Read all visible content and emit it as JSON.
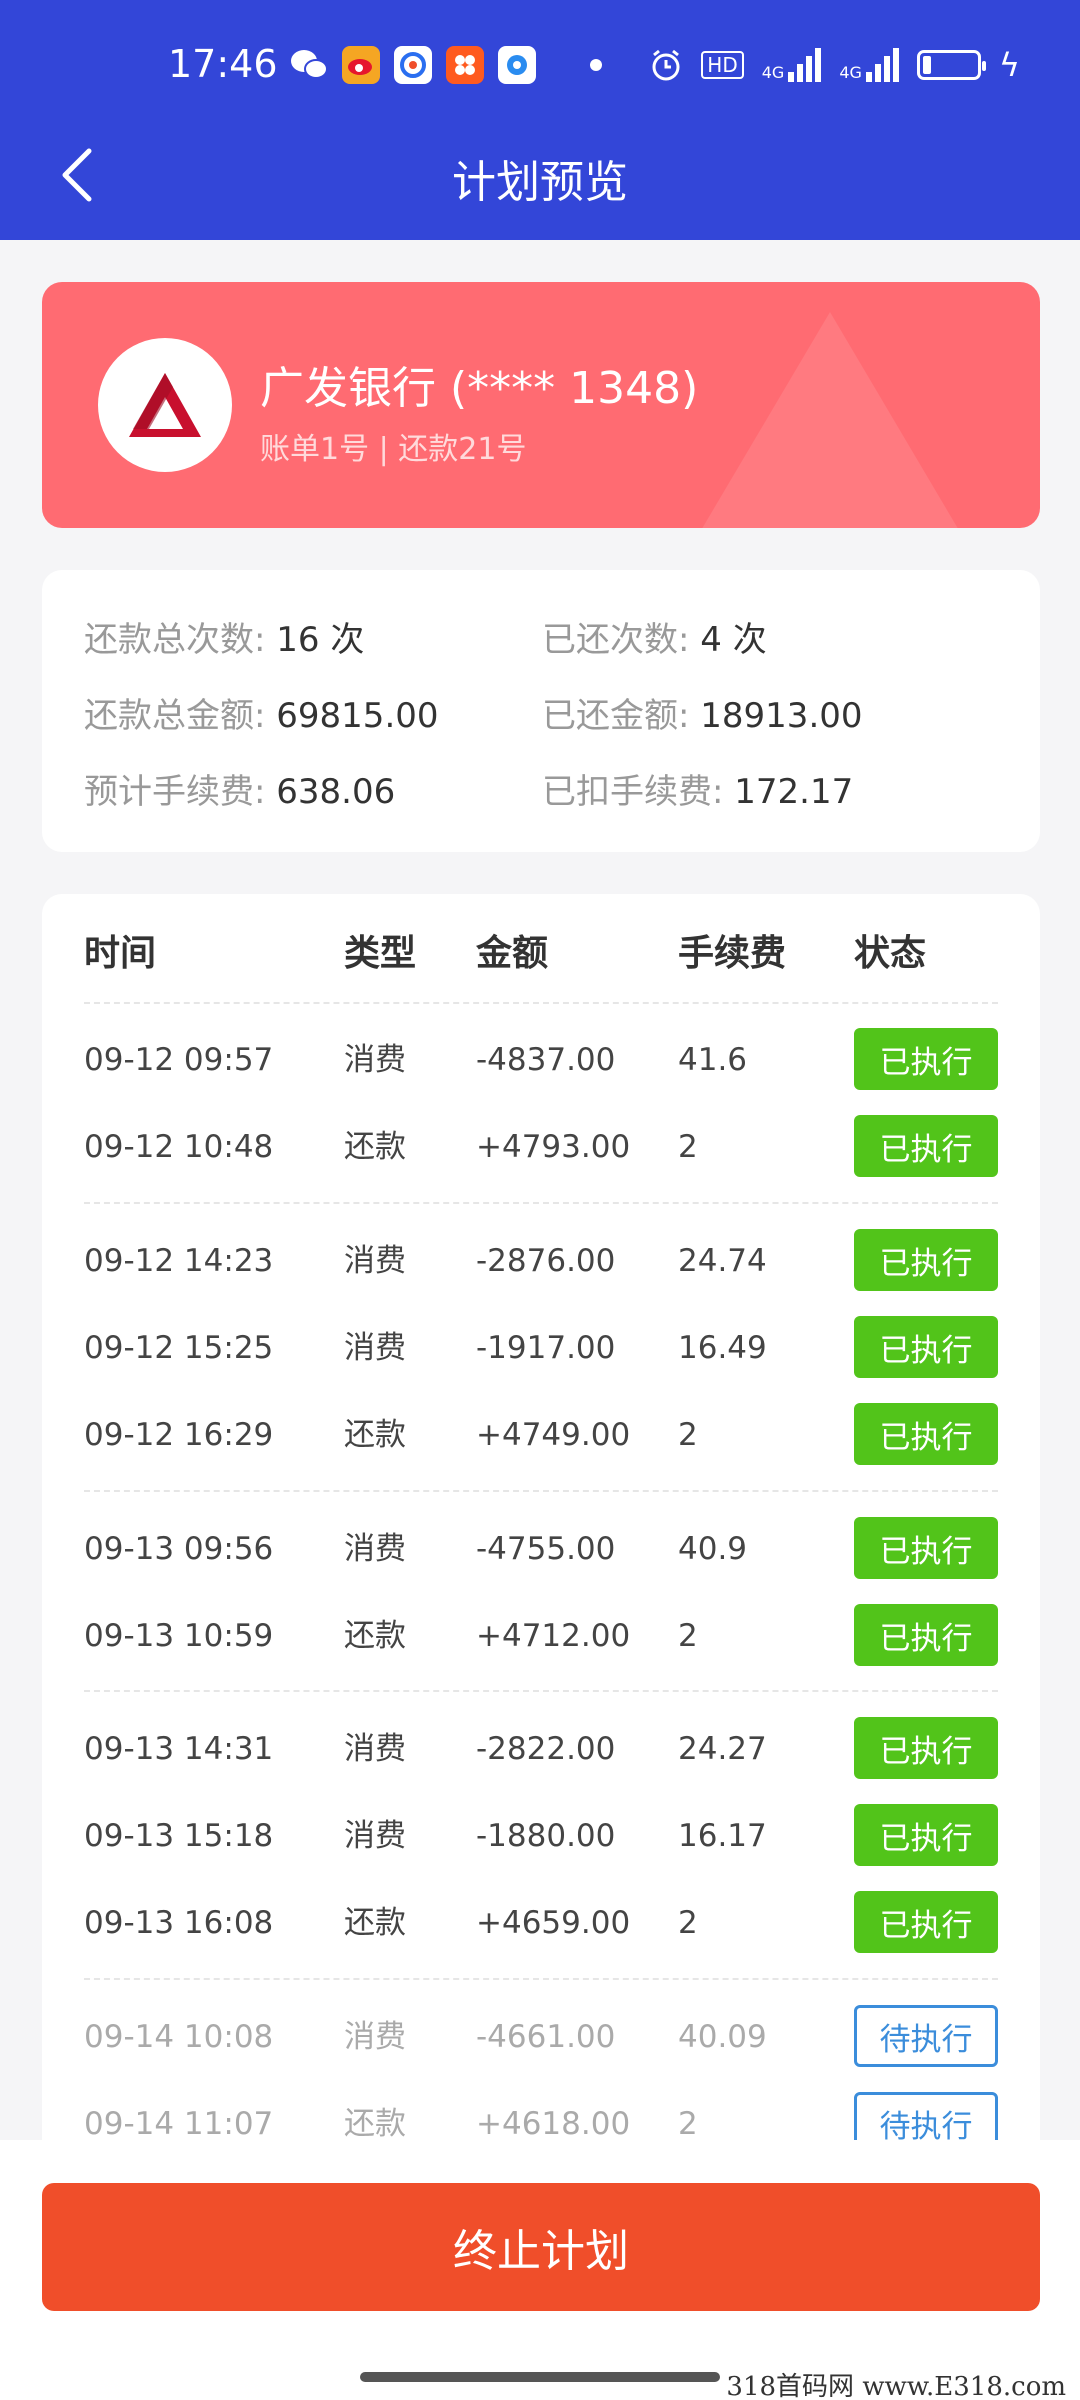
{
  "status_bar": {
    "time": "17:46",
    "hd": "HD",
    "net1": "4G",
    "net2": "4G"
  },
  "header": {
    "back_icon": "chevron-left-icon",
    "title": "计划预览"
  },
  "bank_card": {
    "name": "广发银行 (**** 1348)",
    "sub": "账单1号 | 还款21号",
    "logo_color": "#c8102e"
  },
  "summary": {
    "total_times_label": "还款总次数:",
    "total_times_value": "16 次",
    "paid_times_label": "已还次数:",
    "paid_times_value": "4 次",
    "total_amount_label": "还款总金额:",
    "total_amount_value": "69815.00",
    "paid_amount_label": "已还金额:",
    "paid_amount_value": "18913.00",
    "est_fee_label": "预计手续费:",
    "est_fee_value": "638.06",
    "paid_fee_label": "已扣手续费:",
    "paid_fee_value": "172.17"
  },
  "table": {
    "headers": [
      "时间",
      "类型",
      "金额",
      "手续费",
      "状态"
    ],
    "rows": [
      {
        "time": "09-12 09:57",
        "type": "消费",
        "amount": "-4837.00",
        "fee": "41.6",
        "status": "已执行"
      },
      {
        "time": "09-12 10:48",
        "type": "还款",
        "amount": "+4793.00",
        "fee": "2",
        "status": "已执行"
      },
      {
        "time": "09-12 14:23",
        "type": "消费",
        "amount": "-2876.00",
        "fee": "24.74",
        "status": "已执行"
      },
      {
        "time": "09-12 15:25",
        "type": "消费",
        "amount": "-1917.00",
        "fee": "16.49",
        "status": "已执行"
      },
      {
        "time": "09-12 16:29",
        "type": "还款",
        "amount": "+4749.00",
        "fee": "2",
        "status": "已执行"
      },
      {
        "time": "09-13 09:56",
        "type": "消费",
        "amount": "-4755.00",
        "fee": "40.9",
        "status": "已执行"
      },
      {
        "time": "09-13 10:59",
        "type": "还款",
        "amount": "+4712.00",
        "fee": "2",
        "status": "已执行"
      },
      {
        "time": "09-13 14:31",
        "type": "消费",
        "amount": "-2822.00",
        "fee": "24.27",
        "status": "已执行"
      },
      {
        "time": "09-13 15:18",
        "type": "消费",
        "amount": "-1880.00",
        "fee": "16.17",
        "status": "已执行"
      },
      {
        "time": "09-13 16:08",
        "type": "还款",
        "amount": "+4659.00",
        "fee": "2",
        "status": "已执行"
      },
      {
        "time": "09-14 10:08",
        "type": "消费",
        "amount": "-4661.00",
        "fee": "40.09",
        "status": "待执行"
      },
      {
        "time": "09-14 11:07",
        "type": "还款",
        "amount": "+4618.00",
        "fee": "2",
        "status": "待执行"
      }
    ]
  },
  "bottom": {
    "stop_label": "终止计划"
  },
  "watermark": "318首码网 www.E318.com",
  "colors": {
    "header": "#3346d8",
    "card": "#ff6b72",
    "done": "#52c41a",
    "todo": "#3b8ddb",
    "stop": "#f04e2a"
  }
}
